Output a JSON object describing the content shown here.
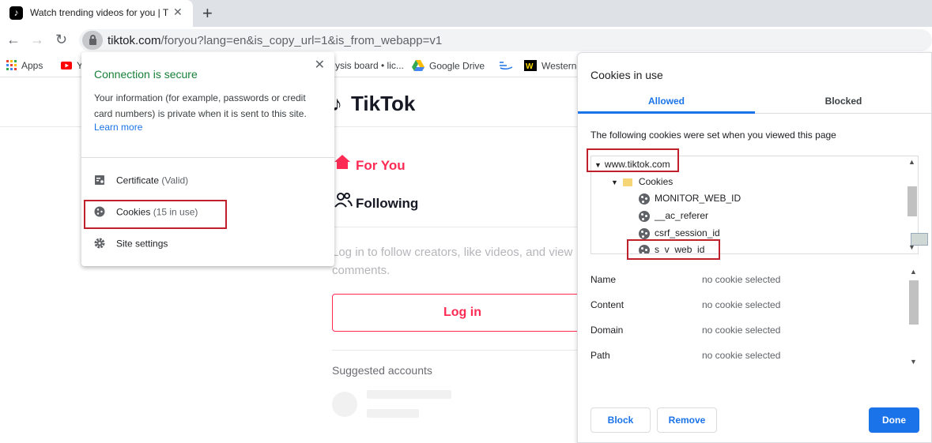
{
  "browser": {
    "tab": {
      "title": "Watch trending videos for you | TikTok",
      "close_label": "✕"
    },
    "new_tab_label": "+",
    "url": {
      "host": "tiktok.com",
      "path": "/foryou?lang=en&is_copy_url=1&is_from_webapp=v1"
    },
    "bookmarks": [
      {
        "label": "Apps"
      },
      {
        "label": "Y"
      },
      {
        "label": "ysis board • lic..."
      },
      {
        "label": "Google Drive"
      },
      {
        "label": ""
      },
      {
        "label": "Western"
      }
    ]
  },
  "page": {
    "logo": "TikTok",
    "nav": [
      {
        "label": "For You",
        "icon": "home-icon",
        "color": "#fe2c55"
      },
      {
        "label": "Following",
        "icon": "people-icon",
        "color": "#161823"
      }
    ],
    "promo_text": "Log in to follow creators, like videos, and view comments.",
    "login_label": "Log in",
    "suggested_label": "Suggested accounts"
  },
  "site_info": {
    "title": "Connection is secure",
    "description": "Your information (for example, passwords or credit card numbers) is private when it is sent to this site.",
    "learn_more": "Learn more",
    "close_label": "✕",
    "rows": [
      {
        "label": "Certificate",
        "detail": "(Valid)",
        "icon": "certificate-icon"
      },
      {
        "label": "Cookies",
        "detail": "(15 in use)",
        "icon": "cookie-icon"
      },
      {
        "label": "Site settings",
        "detail": "",
        "icon": "gear-icon"
      }
    ]
  },
  "cookies_dialog": {
    "title": "Cookies in use",
    "tabs": [
      {
        "label": "Allowed",
        "active": true
      },
      {
        "label": "Blocked",
        "active": false
      }
    ],
    "intro": "The following cookies were set when you viewed this page",
    "tree": {
      "domain": "www.tiktok.com",
      "folder": "Cookies",
      "items": [
        "MONITOR_WEB_ID",
        "__ac_referer",
        "csrf_session_id",
        "s_v_web_id"
      ]
    },
    "details": [
      {
        "label": "Name",
        "value": "no cookie selected"
      },
      {
        "label": "Content",
        "value": "no cookie selected"
      },
      {
        "label": "Domain",
        "value": "no cookie selected"
      },
      {
        "label": "Path",
        "value": "no cookie selected"
      }
    ],
    "buttons": {
      "block": "Block",
      "remove": "Remove",
      "done": "Done"
    }
  },
  "colors": {
    "accent": "#1a73e8",
    "secure": "#188038",
    "tiktok": "#fe2c55",
    "highlight": "#c0202a"
  }
}
